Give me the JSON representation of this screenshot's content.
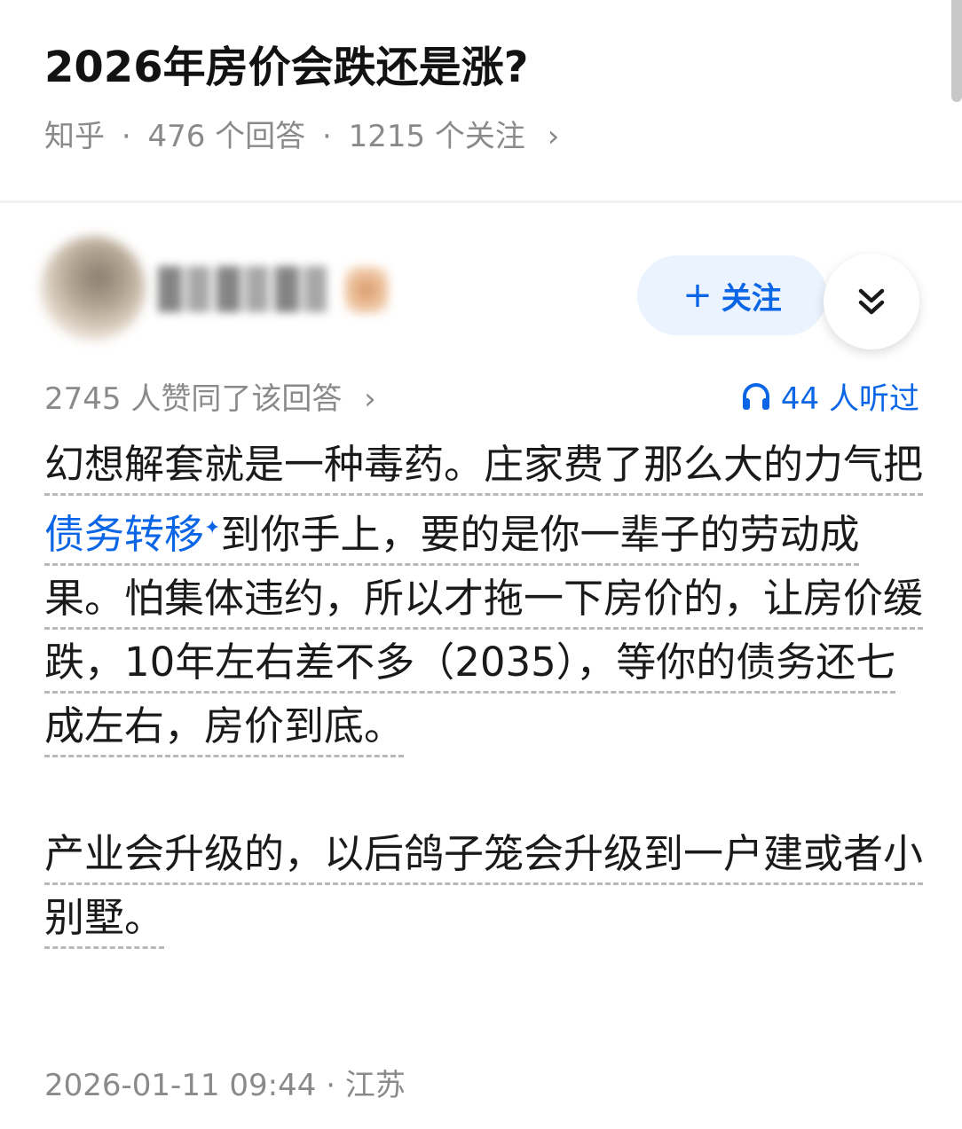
{
  "question": {
    "title": "2026年房价会跌还是涨?",
    "source": "知乎",
    "answers_count": "476 个回答",
    "followers_count": "1215 个关注",
    "separator": "·",
    "chevron": "›"
  },
  "author": {
    "follow_label": "关注",
    "follow_plus": "+"
  },
  "stats": {
    "votes_text": "2745 人赞同了该回答",
    "chevron": "›",
    "listen_text": "44 人听过"
  },
  "answer": {
    "p1_a": "幻想解套就是一种毒药。庄家费了那么大的力气把",
    "p1_link": "债务转移",
    "p1_link_mark": "✦",
    "p1_b": "到你手上，要的是你一辈子的劳动成果。怕集体违约，所以才拖一下房价的，让房价缓跌，10年左右差不多（2035），等你的债务还七成左右，房价到底。",
    "p2": "产业会升级的，以后鸽子笼会升级到一户建或者小别墅。"
  },
  "footer": {
    "timestamp": "2026-01-11 09:44",
    "separator": "·",
    "location": "江苏"
  },
  "colors": {
    "accent": "#0a66e6",
    "meta_gray": "#8a8a8a",
    "follow_bg": "#ebf3fe"
  }
}
